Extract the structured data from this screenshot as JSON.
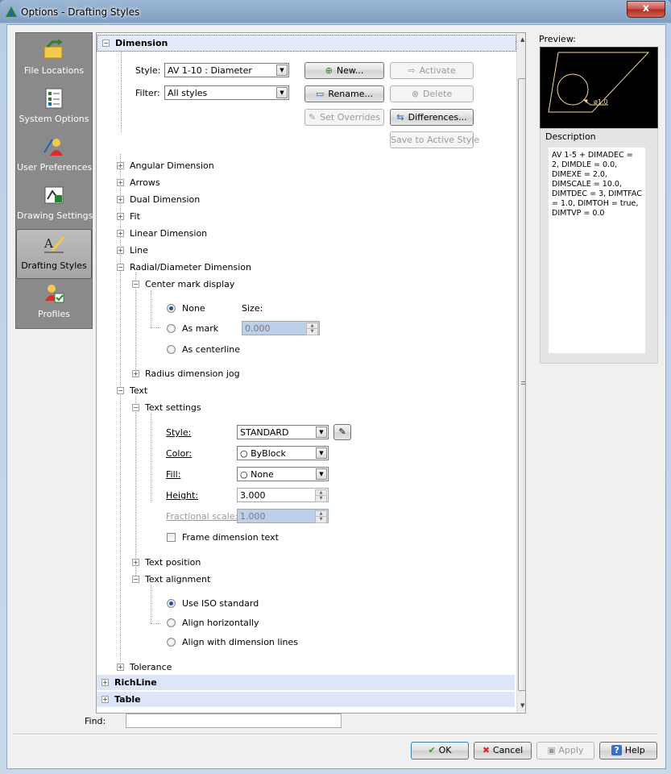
{
  "window": {
    "title": "Options - Drafting Styles",
    "close_label": "x"
  },
  "nav": {
    "items": [
      {
        "label": "File Locations",
        "icon": "folder-arrow-icon"
      },
      {
        "label": "System Options",
        "icon": "checklist-icon"
      },
      {
        "label": "User Preferences",
        "icon": "user-prefs-icon"
      },
      {
        "label": "Drawing Settings",
        "icon": "drawing-settings-icon"
      },
      {
        "label": "Drafting Styles",
        "icon": "drafting-styles-icon"
      },
      {
        "label": "Profiles",
        "icon": "profiles-icon"
      }
    ],
    "active": "Drafting Styles"
  },
  "tree": {
    "dimension": "Dimension",
    "style_label": "Style:",
    "style_value": "AV 1-10 : Diameter",
    "filter_label": "Filter:",
    "filter_value": "All styles",
    "buttons": {
      "new": "New...",
      "activate": "Activate",
      "rename": "Rename...",
      "delete": "Delete",
      "set_overrides": "Set Overrides",
      "differences": "Differences...",
      "save_active": "Save to Active Style"
    },
    "sections": [
      "Angular Dimension",
      "Arrows",
      "Dual Dimension",
      "Fit",
      "Linear Dimension",
      "Line",
      "Radial/Diameter Dimension"
    ],
    "center_mark": {
      "label": "Center mark display",
      "none": "None",
      "size_label": "Size:",
      "as_mark": "As mark",
      "size_value": "0.000",
      "as_centerline": "As centerline",
      "selected": "None"
    },
    "radius_jog": "Radius dimension jog",
    "text": "Text",
    "text_settings": {
      "label": "Text settings",
      "style_label": "Style:",
      "style_value": "STANDARD",
      "color_label": "Color:",
      "color_value": "ByBlock",
      "fill_label": "Fill:",
      "fill_value": "None",
      "height_label": "Height:",
      "height_value": "3.000",
      "frac_label": "Fractional scale:",
      "frac_value": "1.000",
      "frame_label": "Frame dimension text"
    },
    "text_position": "Text position",
    "text_alignment": {
      "label": "Text alignment",
      "iso": "Use ISO standard",
      "horiz": "Align horizontally",
      "with_lines": "Align with dimension lines",
      "selected": "Use ISO standard"
    },
    "tolerance": "Tolerance",
    "richline": "RichLine",
    "table": "Table"
  },
  "preview": {
    "label": "Preview:",
    "dim_text": "ø1.0"
  },
  "description": {
    "label": "Description",
    "text": "AV 1-5 + DIMADEC = 2, DIMDLE = 0.0, DIMEXE = 2.0, DIMSCALE = 10.0, DIMTDEC = 3, DIMTFAC = 1.0, DIMTOH = true, DIMTVP = 0.0"
  },
  "find": {
    "label": "Find:",
    "value": ""
  },
  "footer": {
    "ok": "OK",
    "cancel": "Cancel",
    "apply": "Apply",
    "help": "Help"
  },
  "colors": {
    "accent": "#2a4f96",
    "group_bg": "#dce6f8",
    "preview_line": "#f2d7a0"
  }
}
